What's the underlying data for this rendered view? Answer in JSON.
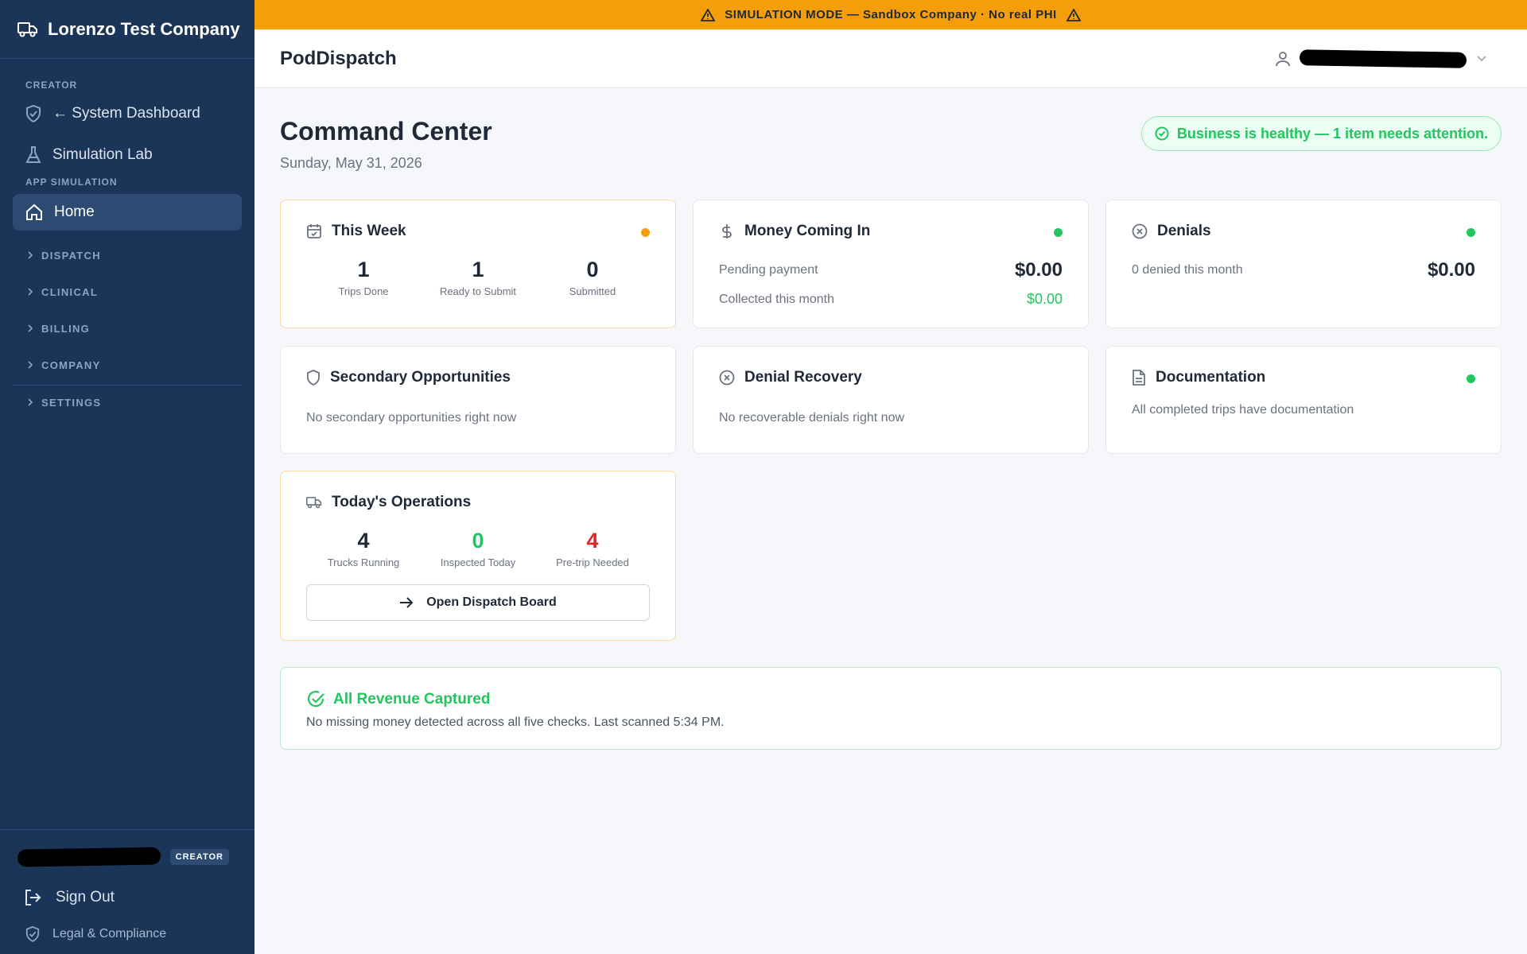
{
  "sidebar": {
    "company": "Lorenzo Test Company",
    "creator_label": "CREATOR",
    "system_dashboard": "← System Dashboard",
    "simulation_lab": "Simulation Lab",
    "app_sim_label": "APP SIMULATION",
    "home": "Home",
    "groups": [
      "DISPATCH",
      "CLINICAL",
      "BILLING",
      "COMPANY",
      "SETTINGS"
    ],
    "role_badge": "CREATOR",
    "sign_out": "Sign Out",
    "legal": "Legal & Compliance"
  },
  "banner": {
    "text": "SIMULATION MODE — Sandbox Company · No real PHI"
  },
  "header": {
    "app_name": "PodDispatch"
  },
  "page": {
    "title": "Command Center",
    "date": "Sunday, May 31, 2026",
    "health": "Business is healthy — 1 item needs attention."
  },
  "cards": {
    "week": {
      "title": "This Week",
      "stats": [
        {
          "value": "1",
          "label": "Trips Done"
        },
        {
          "value": "1",
          "label": "Ready to Submit"
        },
        {
          "value": "0",
          "label": "Submitted"
        }
      ]
    },
    "money": {
      "title": "Money Coming In",
      "pending_label": "Pending payment",
      "pending_value": "$0.00",
      "collected_label": "Collected this month",
      "collected_value": "$0.00"
    },
    "denials": {
      "title": "Denials",
      "label": "0 denied this month",
      "value": "$0.00"
    },
    "secondary": {
      "title": "Secondary Opportunities",
      "note": "No secondary opportunities right now"
    },
    "recovery": {
      "title": "Denial Recovery",
      "note": "No recoverable denials right now"
    },
    "docs": {
      "title": "Documentation",
      "note": "All completed trips have documentation"
    },
    "ops": {
      "title": "Today's Operations",
      "stats": [
        {
          "value": "4",
          "label": "Trucks Running"
        },
        {
          "value": "0",
          "label": "Inspected Today"
        },
        {
          "value": "4",
          "label": "Pre-trip Needed"
        }
      ],
      "button": "Open Dispatch Board"
    }
  },
  "revenue": {
    "title": "All Revenue Captured",
    "note": "No missing money detected across all five checks. Last scanned 5:34 PM."
  },
  "colors": {
    "sidebar": "#1b3558",
    "banner": "#f59e0b",
    "success": "#22c55e",
    "danger": "#dc2626",
    "warning": "#f59e0b"
  }
}
